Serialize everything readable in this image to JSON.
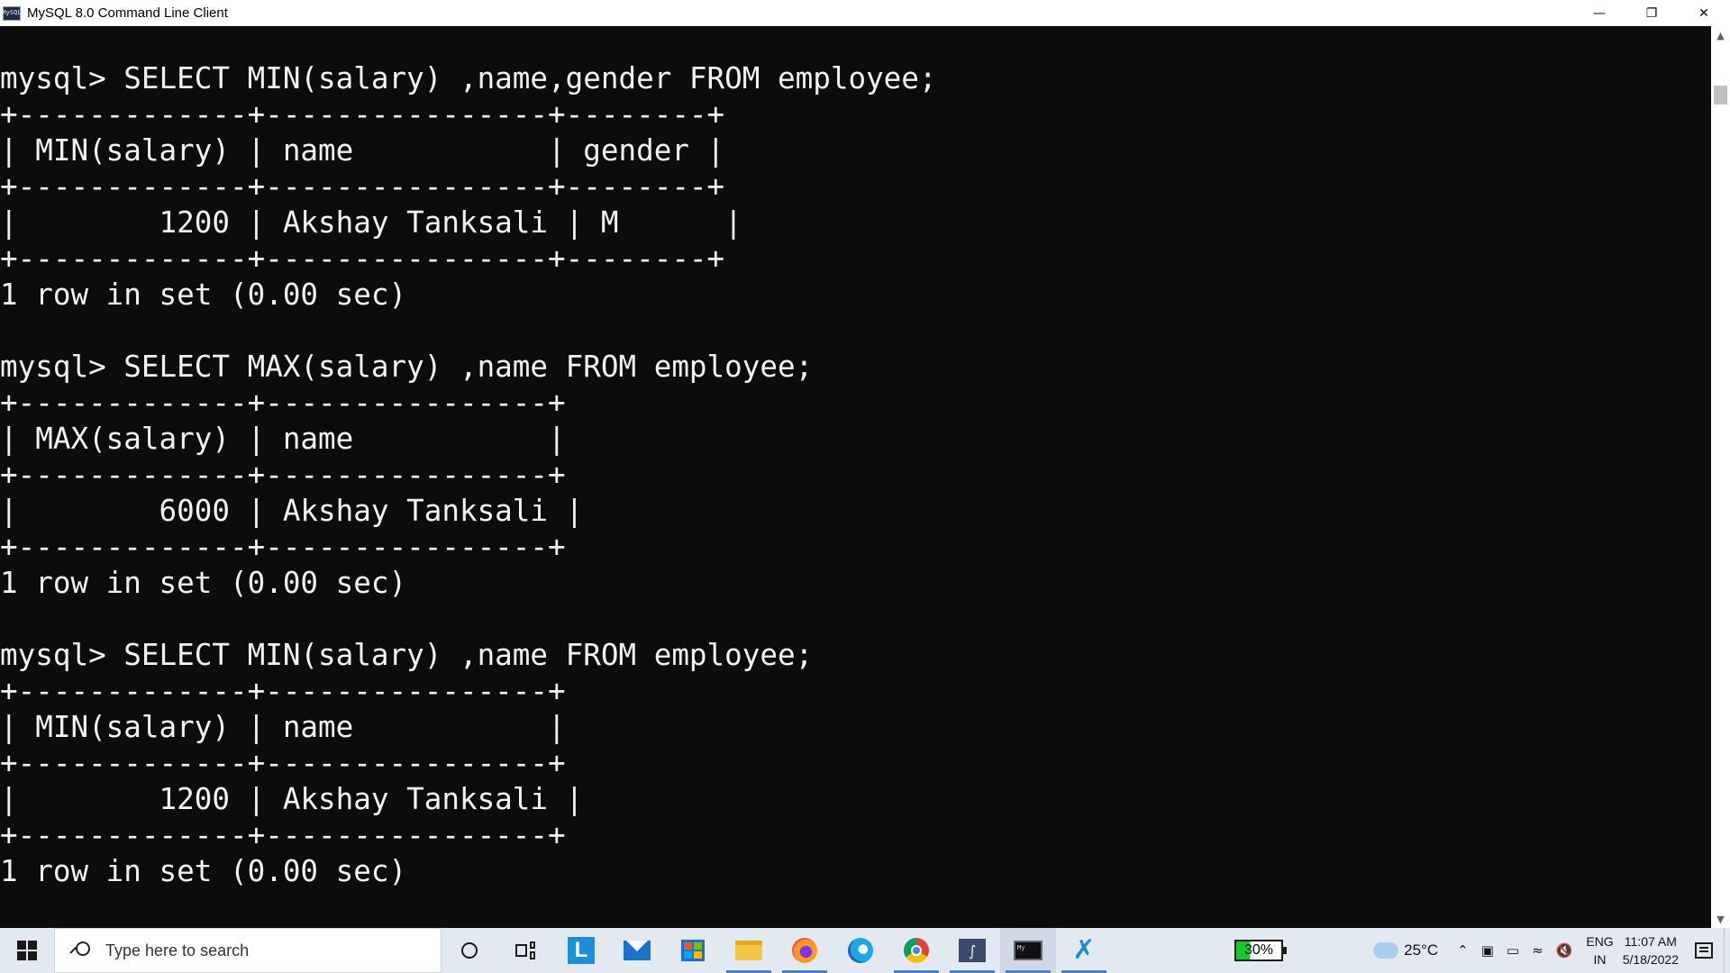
{
  "window": {
    "title": "MySQL 8.0 Command Line Client",
    "icon_label": "MySQL",
    "controls": [
      "minimize-icon",
      "restore-icon",
      "close-icon"
    ]
  },
  "console": {
    "lines": [
      "mysql> SELECT MIN(salary) ,name,gender FROM employee;",
      "+-------------+----------------+--------+",
      "| MIN(salary) | name           | gender |",
      "+-------------+----------------+--------+",
      "|        1200 | Akshay Tanksali | M      |",
      "+-------------+----------------+--------+",
      "1 row in set (0.00 sec)",
      "",
      "mysql> SELECT MAX(salary) ,name FROM employee;",
      "+-------------+----------------+",
      "| MAX(salary) | name           |",
      "+-------------+----------------+",
      "|        6000 | Akshay Tanksali |",
      "+-------------+----------------+",
      "1 row in set (0.00 sec)",
      "",
      "mysql> SELECT MIN(salary) ,name FROM employee;",
      "+-------------+----------------+",
      "| MIN(salary) | name           |",
      "+-------------+----------------+",
      "|        1200 | Akshay Tanksali |",
      "+-------------+----------------+",
      "1 row in set (0.00 sec)"
    ]
  },
  "taskbar": {
    "search_placeholder": "Type here to search",
    "apps": [
      {
        "name": "cortana-icon",
        "state": "normal"
      },
      {
        "name": "task-view-icon",
        "state": "normal"
      },
      {
        "name": "learning-app-icon",
        "state": "normal"
      },
      {
        "name": "mail-icon",
        "state": "normal"
      },
      {
        "name": "microsoft-store-icon",
        "state": "normal"
      },
      {
        "name": "file-explorer-icon",
        "state": "open"
      },
      {
        "name": "firefox-icon",
        "state": "open"
      },
      {
        "name": "edge-icon",
        "state": "normal"
      },
      {
        "name": "chrome-icon",
        "state": "open"
      },
      {
        "name": "mysql-workbench-icon",
        "state": "open"
      },
      {
        "name": "mysql-cli-icon",
        "state": "active"
      },
      {
        "name": "vscode-icon",
        "state": "open"
      }
    ],
    "battery_percent": "30%",
    "battery_level": 0.3,
    "temperature": "25°C",
    "language_top": "ENG",
    "language_bottom": "IN",
    "time": "11:07 AM",
    "date": "5/18/2022",
    "colors": {
      "taskbar_bg": "#e3e9f1",
      "console_bg": "#0c0c0c",
      "console_fg": "#f2f2f2",
      "accent": "#4a84c6"
    }
  }
}
